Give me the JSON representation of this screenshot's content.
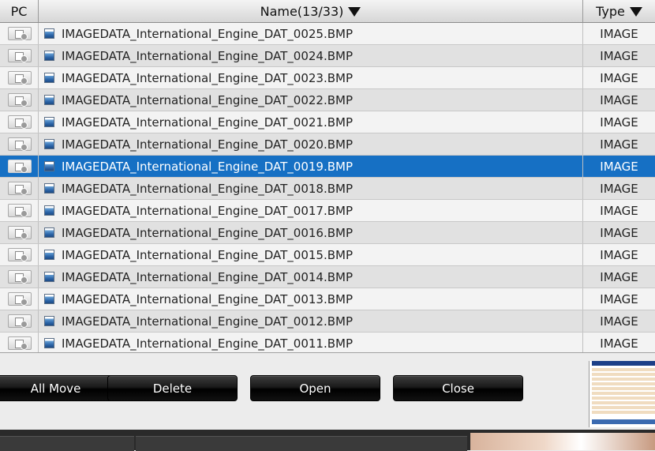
{
  "header": {
    "pc": "PC",
    "name": "Name(13/33)",
    "type": "Type"
  },
  "rows": [
    {
      "name": "IMAGEDATA_International_Engine_DAT_0025.BMP",
      "type": "IMAGE"
    },
    {
      "name": "IMAGEDATA_International_Engine_DAT_0024.BMP",
      "type": "IMAGE"
    },
    {
      "name": "IMAGEDATA_International_Engine_DAT_0023.BMP",
      "type": "IMAGE"
    },
    {
      "name": "IMAGEDATA_International_Engine_DAT_0022.BMP",
      "type": "IMAGE"
    },
    {
      "name": "IMAGEDATA_International_Engine_DAT_0021.BMP",
      "type": "IMAGE"
    },
    {
      "name": "IMAGEDATA_International_Engine_DAT_0020.BMP",
      "type": "IMAGE"
    },
    {
      "name": "IMAGEDATA_International_Engine_DAT_0019.BMP",
      "type": "IMAGE"
    },
    {
      "name": "IMAGEDATA_International_Engine_DAT_0018.BMP",
      "type": "IMAGE"
    },
    {
      "name": "IMAGEDATA_International_Engine_DAT_0017.BMP",
      "type": "IMAGE"
    },
    {
      "name": "IMAGEDATA_International_Engine_DAT_0016.BMP",
      "type": "IMAGE"
    },
    {
      "name": "IMAGEDATA_International_Engine_DAT_0015.BMP",
      "type": "IMAGE"
    },
    {
      "name": "IMAGEDATA_International_Engine_DAT_0014.BMP",
      "type": "IMAGE"
    },
    {
      "name": "IMAGEDATA_International_Engine_DAT_0013.BMP",
      "type": "IMAGE"
    },
    {
      "name": "IMAGEDATA_International_Engine_DAT_0012.BMP",
      "type": "IMAGE"
    },
    {
      "name": "IMAGEDATA_International_Engine_DAT_0011.BMP",
      "type": "IMAGE"
    }
  ],
  "selected_row": "IMAGEDATA_International_Engine_DAT_0019.BMP",
  "buttons": {
    "all_move": "All Move",
    "delete": "Delete",
    "open": "Open",
    "close": "Close"
  },
  "icons": {
    "sort": "triangle-down-icon",
    "pc_transfer": "pc-transfer-icon",
    "file": "bitmap-image-icon"
  },
  "colors": {
    "selection": "#1670c4",
    "button": "#000000"
  }
}
